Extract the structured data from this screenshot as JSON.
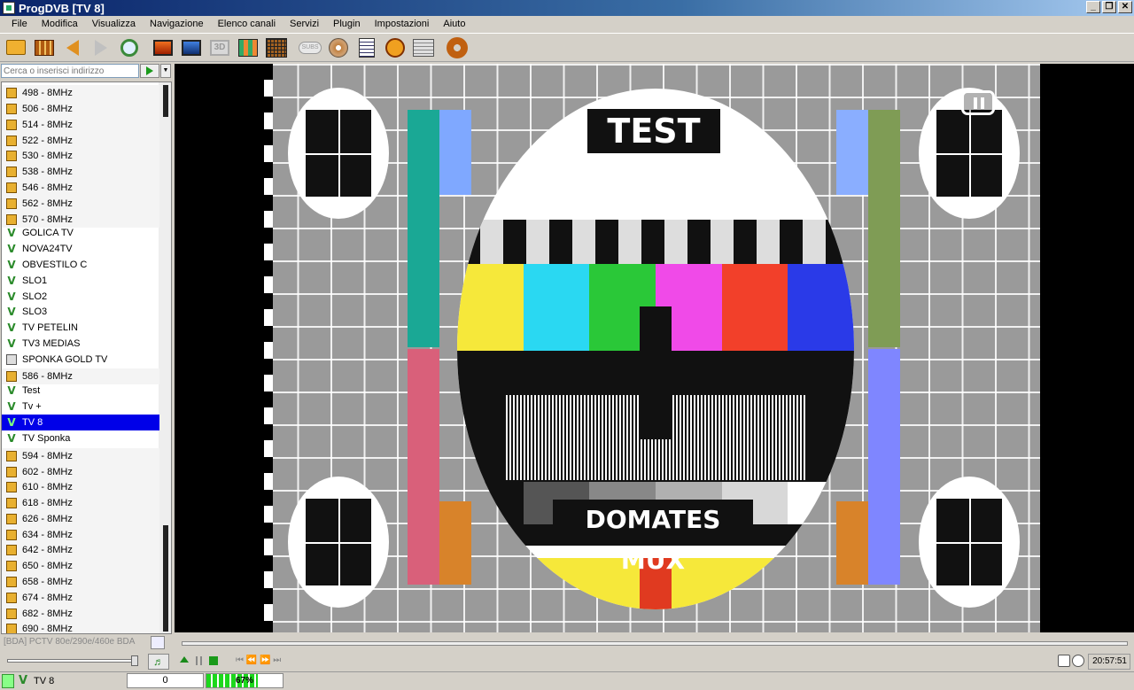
{
  "window": {
    "title": "ProgDVB [TV 8]"
  },
  "window_buttons": {
    "minimize": "_",
    "restore": "❐",
    "close": "✕"
  },
  "menu": [
    "File",
    "Modifica",
    "Visualizza",
    "Navigazione",
    "Elenco canali",
    "Servizi",
    "Plugin",
    "Impostazioni",
    "Aiuto"
  ],
  "toolbar_icons": [
    "open-folder-icon",
    "film-icon",
    "back-arrow-icon",
    "forward-arrow-icon",
    "search-globe-icon",
    "monitor-orange-icon",
    "monitor-blue-icon",
    "3d-icon",
    "mosaic-icon",
    "grid-icon",
    "subtitles-icon",
    "disc-record-icon",
    "list-icon",
    "clock-icon",
    "epg-icon",
    "settings-gear-icon"
  ],
  "toolbar_text": {
    "three_d": "3D",
    "subs": "SUBS"
  },
  "search": {
    "placeholder": "Cerca o inserisci indirizzo"
  },
  "channel_list": {
    "rows": [
      {
        "label": "498 - 8MHz",
        "kind": "freq"
      },
      {
        "label": "506 - 8MHz",
        "kind": "freq"
      },
      {
        "label": "514 - 8MHz",
        "kind": "freq"
      },
      {
        "label": "522 - 8MHz",
        "kind": "freq"
      },
      {
        "label": "530 - 8MHz",
        "kind": "freq"
      },
      {
        "label": "538 - 8MHz",
        "kind": "freq"
      },
      {
        "label": "546 - 8MHz",
        "kind": "freq"
      },
      {
        "label": "562 - 8MHz",
        "kind": "freq"
      },
      {
        "label": "570 - 8MHz",
        "kind": "freq"
      },
      {
        "label": "GOLICA TV",
        "kind": "channel"
      },
      {
        "label": "NOVA24TV",
        "kind": "channel"
      },
      {
        "label": "OBVESTILO C",
        "kind": "channel"
      },
      {
        "label": "SLO1",
        "kind": "channel"
      },
      {
        "label": "SLO2",
        "kind": "channel"
      },
      {
        "label": "SLO3",
        "kind": "channel"
      },
      {
        "label": "TV PETELIN",
        "kind": "channel"
      },
      {
        "label": "TV3 MEDIAS",
        "kind": "channel"
      },
      {
        "label": "SPONKA GOLD TV",
        "kind": "tv"
      },
      {
        "label": "586 - 8MHz",
        "kind": "freq"
      },
      {
        "label": "Test",
        "kind": "channel"
      },
      {
        "label": "Tv +",
        "kind": "channel"
      },
      {
        "label": "TV 8",
        "kind": "channel",
        "selected": true
      },
      {
        "label": "TV Sponka",
        "kind": "channel"
      },
      {
        "label": "594 - 8MHz",
        "kind": "freq"
      },
      {
        "label": "602 - 8MHz",
        "kind": "freq"
      },
      {
        "label": "610 - 8MHz",
        "kind": "freq"
      },
      {
        "label": "618 - 8MHz",
        "kind": "freq"
      },
      {
        "label": "626 - 8MHz",
        "kind": "freq"
      },
      {
        "label": "634 - 8MHz",
        "kind": "freq"
      },
      {
        "label": "642 - 8MHz",
        "kind": "freq"
      },
      {
        "label": "650 - 8MHz",
        "kind": "freq"
      },
      {
        "label": "658 - 8MHz",
        "kind": "freq"
      },
      {
        "label": "674 - 8MHz",
        "kind": "freq"
      },
      {
        "label": "682 - 8MHz",
        "kind": "freq"
      },
      {
        "label": "690 - 8MHz",
        "kind": "freq"
      }
    ]
  },
  "video": {
    "top_label": "TEST",
    "bottom_label": "DOMATES MUX"
  },
  "info": {
    "device": "[BDA] PCTV 80e/290e/460e BDA"
  },
  "controls": {
    "audio_icon": "♬",
    "prev_icons": "⏮ ⏪ ⏩ ⏭"
  },
  "clock": {
    "time": "20:57:51"
  },
  "status": {
    "channel": "TV 8",
    "count": "0",
    "signal_text": "67%",
    "signal_level": 0.67
  }
}
